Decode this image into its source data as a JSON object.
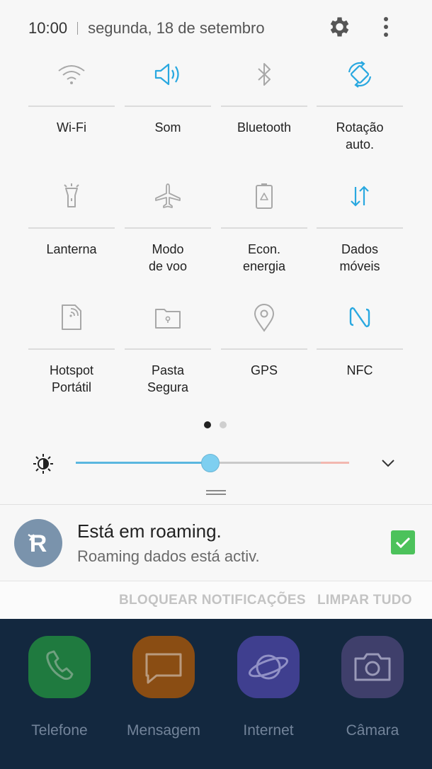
{
  "status": {
    "time": "10:00",
    "date": "segunda, 18 de setembro"
  },
  "header_icons": {
    "settings": "gear-icon",
    "more": "more-vert-icon"
  },
  "colors": {
    "accent": "#29a8e0",
    "inactive": "#a8a8a8",
    "checkbox": "#4cc25b"
  },
  "tiles": [
    {
      "label": "Wi-Fi",
      "icon": "wifi-icon",
      "active": false
    },
    {
      "label": "Som",
      "icon": "sound-icon",
      "active": true
    },
    {
      "label": "Bluetooth",
      "icon": "bluetooth-icon",
      "active": false
    },
    {
      "label": "Rotação\nauto.",
      "icon": "auto-rotate-icon",
      "active": true
    },
    {
      "label": "Lanterna",
      "icon": "flashlight-icon",
      "active": false
    },
    {
      "label": "Modo\nde voo",
      "icon": "airplane-icon",
      "active": false
    },
    {
      "label": "Econ.\nenergia",
      "icon": "battery-saver-icon",
      "active": false
    },
    {
      "label": "Dados\nmóveis",
      "icon": "mobile-data-icon",
      "active": true
    },
    {
      "label": "Hotspot\nPortátil",
      "icon": "hotspot-icon",
      "active": false
    },
    {
      "label": "Pasta\nSegura",
      "icon": "secure-folder-icon",
      "active": false
    },
    {
      "label": "GPS",
      "icon": "location-icon",
      "active": false
    },
    {
      "label": "NFC",
      "icon": "nfc-icon",
      "active": true
    }
  ],
  "pager": {
    "pages": 2,
    "current": 1
  },
  "brightness": {
    "level": 0.49
  },
  "notification": {
    "title": "Está em roaming.",
    "text": "Roaming dados está activ.",
    "checked": true
  },
  "actions": {
    "block": "BLOQUEAR NOTIFICAÇÕES",
    "clear": "LIMPAR TUDO"
  },
  "dock": [
    {
      "label": "Telefone",
      "icon": "phone-icon",
      "color": "#1f7a3f"
    },
    {
      "label": "Mensagem",
      "icon": "message-icon",
      "color": "#8a4d13"
    },
    {
      "label": "Internet",
      "icon": "internet-icon",
      "color": "#3f3f8f"
    },
    {
      "label": "Câmara",
      "icon": "camera-icon",
      "color": "#3f3f6b"
    }
  ]
}
